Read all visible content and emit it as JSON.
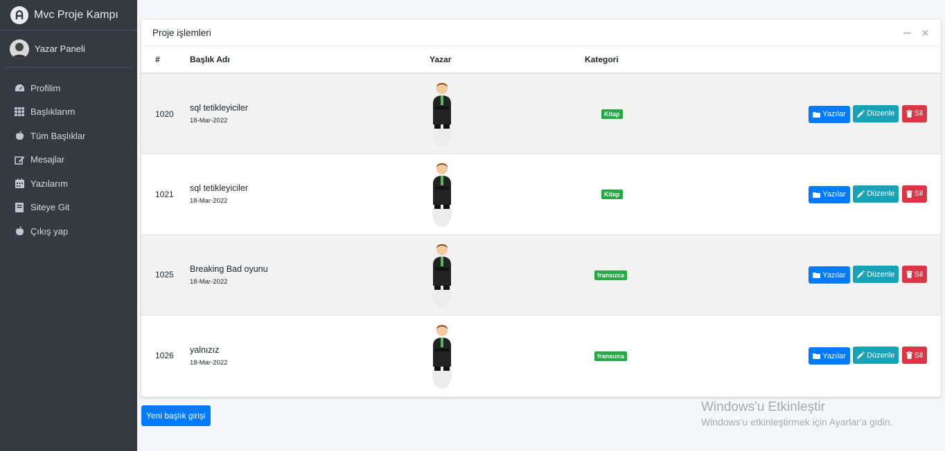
{
  "brand": {
    "title": "Mvc Proje Kampı",
    "icon": "brand-logo-icon"
  },
  "user": {
    "name": "Yazar Paneli",
    "icon": "user-avatar"
  },
  "sidebar": {
    "items": [
      {
        "label": "Profilim",
        "icon": "tachometer-icon"
      },
      {
        "label": "Başlıklarım",
        "icon": "grid-icon"
      },
      {
        "label": "Tüm Başlıklar",
        "icon": "apple-icon"
      },
      {
        "label": "Mesajlar",
        "icon": "edit-icon"
      },
      {
        "label": "Yazılarım",
        "icon": "calendar-icon"
      },
      {
        "label": "Siteye Git",
        "icon": "book-icon"
      },
      {
        "label": "Çıkış yap",
        "icon": "apple-icon"
      }
    ]
  },
  "card": {
    "title": "Proje işlemleri",
    "columns": {
      "id": "#",
      "title": "Başlık Adı",
      "author": "Yazar",
      "category": "Kategori"
    },
    "buttons": {
      "posts": "Yazılar",
      "edit": "Düzenle",
      "delete": "Sil"
    },
    "rows": [
      {
        "id": "1020",
        "title": "sql tetikleyiciler",
        "date": "18-Mar-2022",
        "category": "Kitap"
      },
      {
        "id": "1021",
        "title": "sql tetikleyiciler",
        "date": "18-Mar-2022",
        "category": "Kitap"
      },
      {
        "id": "1025",
        "title": "Breaking Bad oyunu",
        "date": "18-Mar-2022",
        "category": "fransızca"
      },
      {
        "id": "1026",
        "title": "yalnızız",
        "date": "18-Mar-2022",
        "category": "fransızca"
      }
    ]
  },
  "new_button": "Yeni başlık girişi",
  "watermark": {
    "title": "Windows'u Etkinleştir",
    "subtitle": "Windows'u etkinleştirmek için Ayarlar'a gidin."
  },
  "colors": {
    "sidebar": "#343a40",
    "primary": "#007bff",
    "info": "#17a2b8",
    "danger": "#dc3545",
    "success": "#28a745"
  }
}
